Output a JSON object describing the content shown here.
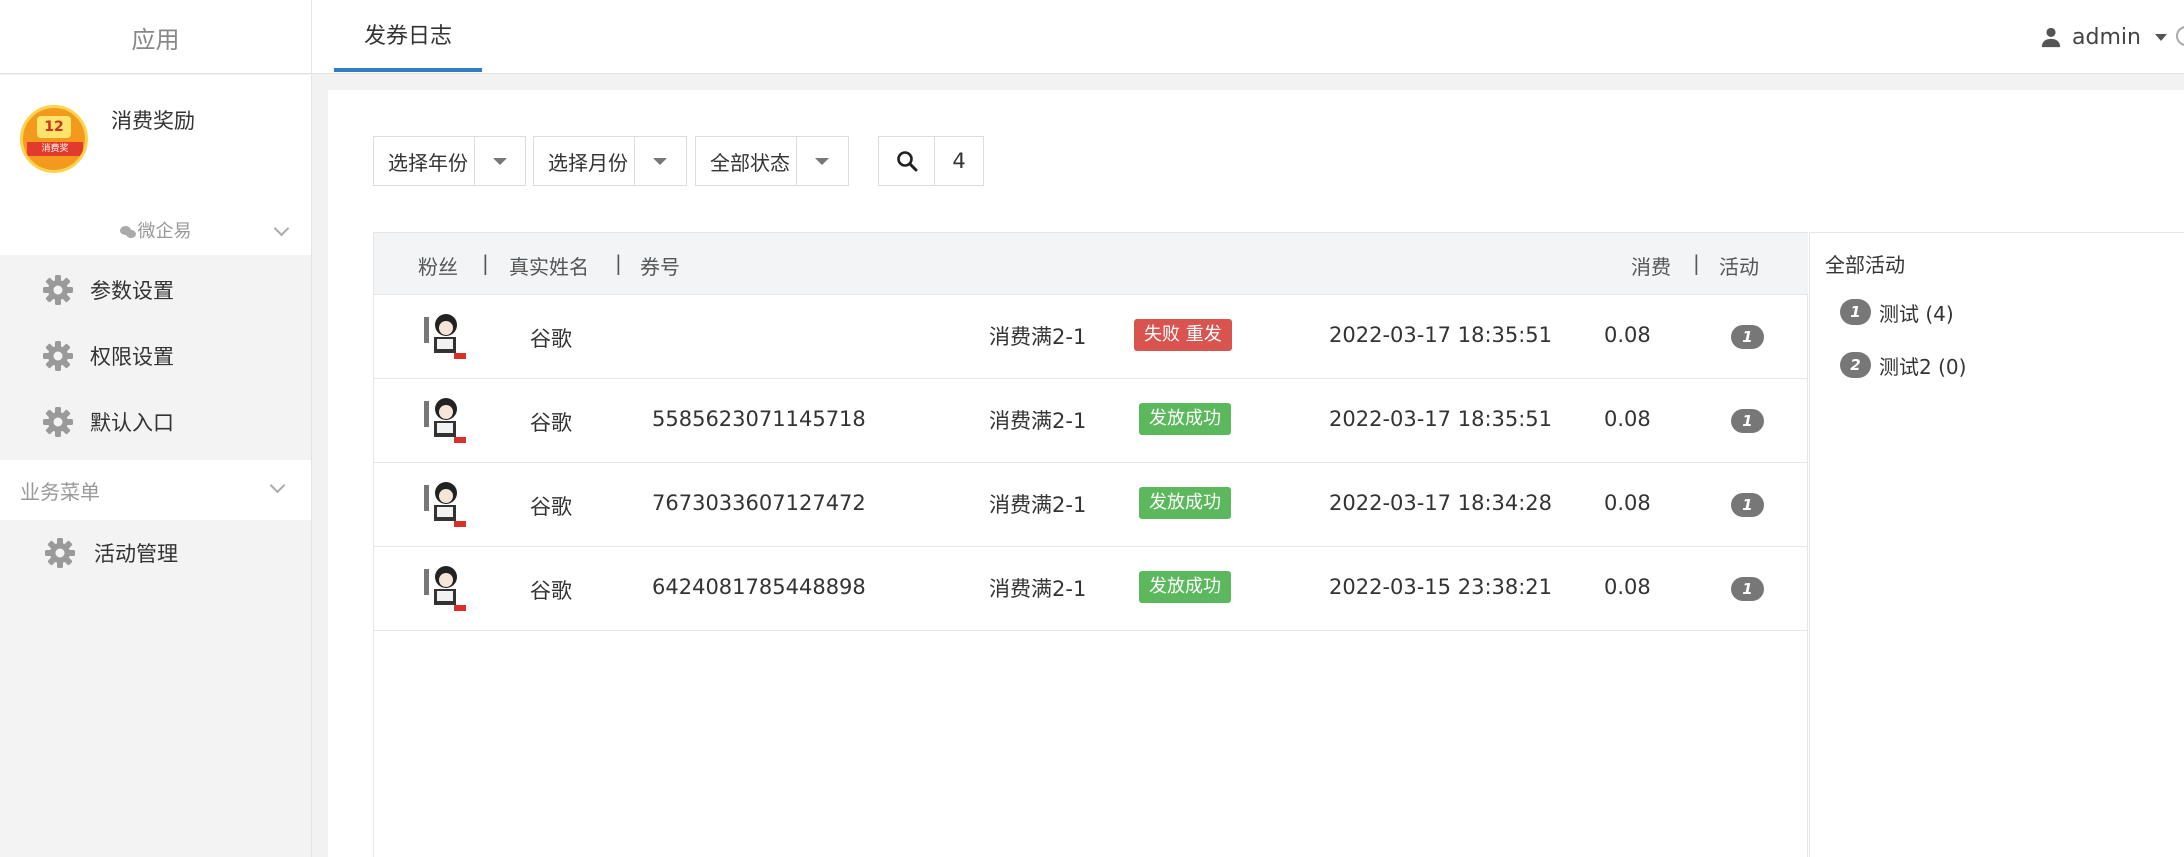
{
  "header": {
    "brand": "应用",
    "active_tab": "发券日志",
    "user": "admin"
  },
  "sidebar": {
    "app_name": "消费奖励",
    "app_logo_number": "12",
    "app_logo_text": "消费奖",
    "app_sub": "微企易",
    "items": [
      {
        "label": "参数设置"
      },
      {
        "label": "权限设置"
      },
      {
        "label": "默认入口"
      }
    ],
    "group_title": "业务菜单",
    "group_items": [
      {
        "label": "活动管理"
      }
    ]
  },
  "filters": {
    "year": "选择年份",
    "month": "选择月份",
    "status": "全部状态",
    "count": "4"
  },
  "table": {
    "headers": {
      "fans": "粉丝",
      "real_name": "真实姓名",
      "code": "券号",
      "amount": "消费",
      "activity": "活动",
      "sep": "|"
    },
    "rows": [
      {
        "name": "谷歌",
        "code": "",
        "activity": "消费满2-1",
        "status": "失败 重发",
        "status_type": "fail",
        "time": "2022-03-17 18:35:51",
        "amount": "0.08",
        "activity_no": "1"
      },
      {
        "name": "谷歌",
        "code": "5585623071145718",
        "activity": "消费满2-1",
        "status": "发放成功",
        "status_type": "ok",
        "time": "2022-03-17 18:35:51",
        "amount": "0.08",
        "activity_no": "1"
      },
      {
        "name": "谷歌",
        "code": "7673033607127472",
        "activity": "消费满2-1",
        "status": "发放成功",
        "status_type": "ok",
        "time": "2022-03-17 18:34:28",
        "amount": "0.08",
        "activity_no": "1"
      },
      {
        "name": "谷歌",
        "code": "6424081785448898",
        "activity": "消费满2-1",
        "status": "发放成功",
        "status_type": "ok",
        "time": "2022-03-15 23:38:21",
        "amount": "0.08",
        "activity_no": "1"
      }
    ]
  },
  "activities": {
    "title": "全部活动",
    "items": [
      {
        "no": "1",
        "label": "测试 (4)"
      },
      {
        "no": "2",
        "label": "测试2 (0)"
      }
    ]
  },
  "colors": {
    "accent": "#2f7fc1",
    "fail": "#d9534f",
    "success": "#5cb85c",
    "pill": "#777777"
  }
}
